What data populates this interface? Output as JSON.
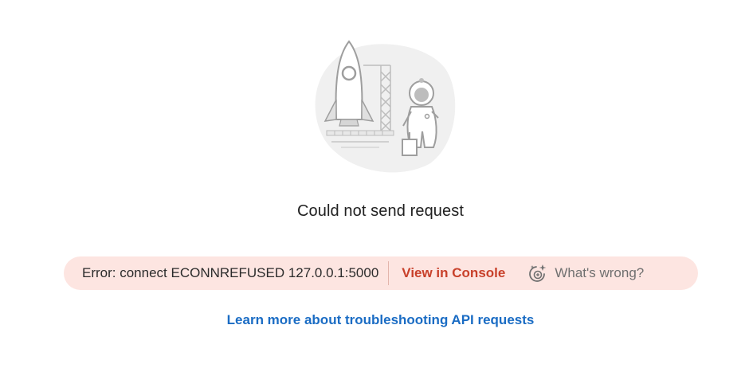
{
  "main": {
    "illustration_icon": "rocket-astronaut-illustration",
    "title": "Could not send request",
    "error": {
      "message": "Error: connect ECONNREFUSED 127.0.0.1:5000",
      "console_link": "View in Console",
      "help_icon": "ai-sparkle-icon",
      "help_label": "What's wrong?"
    },
    "learn_more_link": "Learn more about troubleshooting API requests"
  },
  "colors": {
    "error_bg": "#fde5e1",
    "console_link": "#c8402a",
    "learn_link": "#1a6cc4",
    "title_text": "#212121"
  }
}
